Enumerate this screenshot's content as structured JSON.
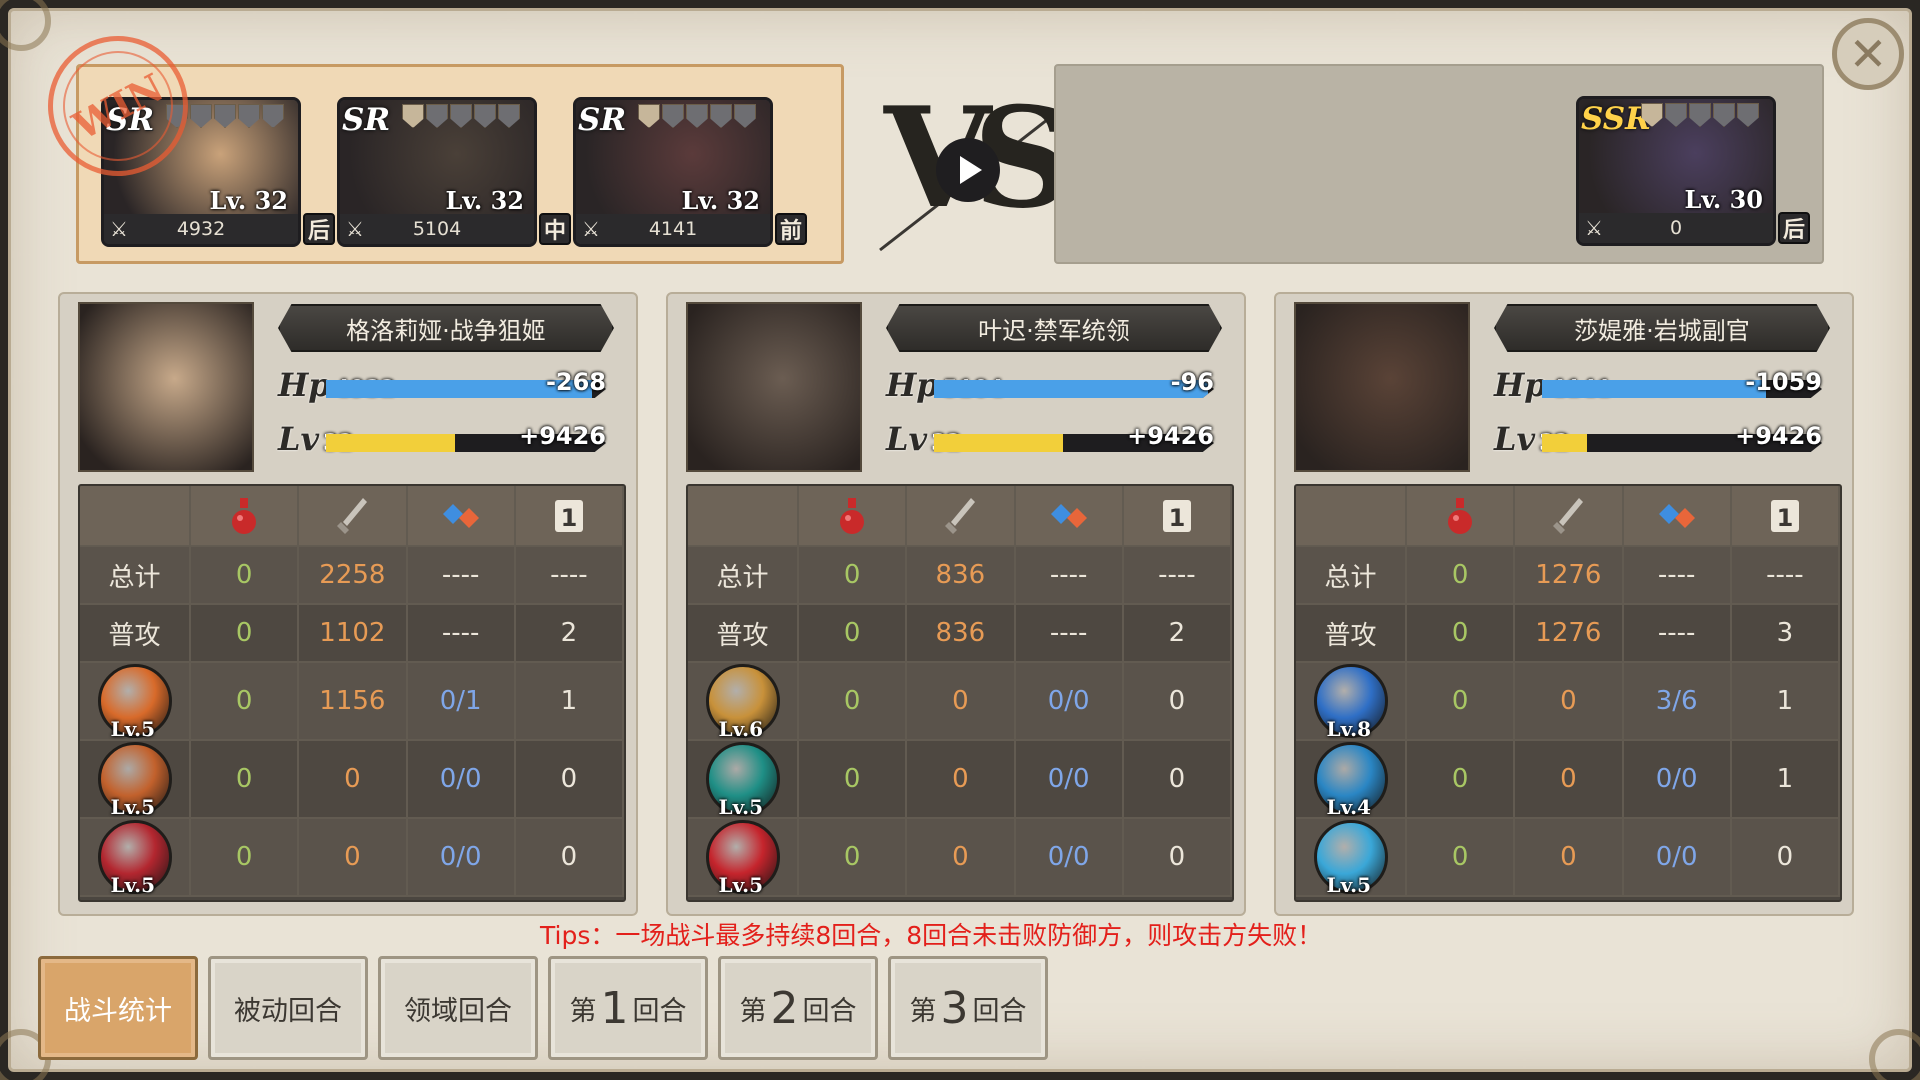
{
  "close_icon": "close-icon",
  "stamp_text": "WIN",
  "vs_text": "VS",
  "left_team": [
    {
      "rarity": "SR",
      "level": "Lv. 32",
      "hp": "4932",
      "position": "后",
      "stars_on": 0,
      "class_icon": "gear-icon"
    },
    {
      "rarity": "SR",
      "level": "Lv. 32",
      "hp": "5104",
      "position": "中",
      "stars_on": 1,
      "class_icon": "crossed-swords-icon"
    },
    {
      "rarity": "SR",
      "level": "Lv. 32",
      "hp": "4141",
      "position": "前",
      "stars_on": 1,
      "class_icon": "crossed-swords-icon"
    }
  ],
  "right_team": [
    {
      "rarity": "SSR",
      "level": "Lv. 30",
      "hp": "0",
      "position": "后",
      "stars_on": 1,
      "class_icon": "crossed-swords-icon"
    }
  ],
  "panels": [
    {
      "name": "格洛莉娅·战争狙姬",
      "hp": "4932",
      "hp_delta": "-268",
      "hp_fill": 0.95,
      "lv": "32",
      "exp": "+9426",
      "exp_fill": 0.46,
      "rows": [
        {
          "label": "总计",
          "c1": "0",
          "c2": "2258",
          "c3": "----",
          "c4": "----"
        },
        {
          "label": "普攻",
          "c1": "0",
          "c2": "1102",
          "c3": "----",
          "c4": "2"
        },
        {
          "skill_lv": "Lv.5",
          "c1": "0",
          "c2": "1156",
          "c3": "0/1",
          "c4": "1",
          "orb": "#d86a2a"
        },
        {
          "skill_lv": "Lv.5",
          "c1": "0",
          "c2": "0",
          "c3": "0/0",
          "c4": "0",
          "orb": "#c2612c"
        },
        {
          "skill_lv": "Lv.5",
          "c1": "0",
          "c2": "0",
          "c3": "0/0",
          "c4": "0",
          "orb": "#b3262f"
        }
      ]
    },
    {
      "name": "叶迟·禁军统领",
      "hp": "5104",
      "hp_delta": "-96",
      "hp_fill": 0.98,
      "lv": "32",
      "exp": "+9426",
      "exp_fill": 0.46,
      "rows": [
        {
          "label": "总计",
          "c1": "0",
          "c2": "836",
          "c3": "----",
          "c4": "----"
        },
        {
          "label": "普攻",
          "c1": "0",
          "c2": "836",
          "c3": "----",
          "c4": "2"
        },
        {
          "skill_lv": "Lv.6",
          "c1": "0",
          "c2": "0",
          "c3": "0/0",
          "c4": "0",
          "orb": "#c8913a"
        },
        {
          "skill_lv": "Lv.5",
          "c1": "0",
          "c2": "0",
          "c3": "0/0",
          "c4": "0",
          "orb": "#1f8f86"
        },
        {
          "skill_lv": "Lv.5",
          "c1": "0",
          "c2": "0",
          "c3": "0/0",
          "c4": "0",
          "orb": "#c5242c"
        }
      ]
    },
    {
      "name": "莎媞雅·岩城副官",
      "hp": "4141",
      "hp_delta": "-1059",
      "hp_fill": 0.8,
      "lv": "32",
      "exp": "+9426",
      "exp_fill": 0.16,
      "rows": [
        {
          "label": "总计",
          "c1": "0",
          "c2": "1276",
          "c3": "----",
          "c4": "----"
        },
        {
          "label": "普攻",
          "c1": "0",
          "c2": "1276",
          "c3": "----",
          "c4": "3"
        },
        {
          "skill_lv": "Lv.8",
          "c1": "0",
          "c2": "0",
          "c3": "3/6",
          "c4": "1",
          "orb": "#2f6fc6"
        },
        {
          "skill_lv": "Lv.4",
          "c1": "0",
          "c2": "0",
          "c3": "0/0",
          "c4": "1",
          "orb": "#2a86c4"
        },
        {
          "skill_lv": "Lv.5",
          "c1": "0",
          "c2": "0",
          "c3": "0/0",
          "c4": "0",
          "orb": "#3aa7d8"
        }
      ]
    }
  ],
  "table_icons": [
    "potion-icon",
    "sword-icon",
    "diamond-icon",
    "turn-icon"
  ],
  "tips": "Tips：一场战斗最多持续8回合，8回合未击败防御方，则攻击方失败！",
  "tabs": [
    {
      "label": "战斗统计",
      "active": true
    },
    {
      "label": "被动回合"
    },
    {
      "label": "领域回合"
    },
    {
      "pre": "第",
      "num": "1",
      "post": "回合"
    },
    {
      "pre": "第",
      "num": "2",
      "post": "回合"
    },
    {
      "pre": "第",
      "num": "3",
      "post": "回合"
    }
  ],
  "colors": {
    "accent": "#d9a56a",
    "hp_bar": "#4aa0e8",
    "exp_bar": "#f2cf3a",
    "tips": "#e3201b"
  }
}
